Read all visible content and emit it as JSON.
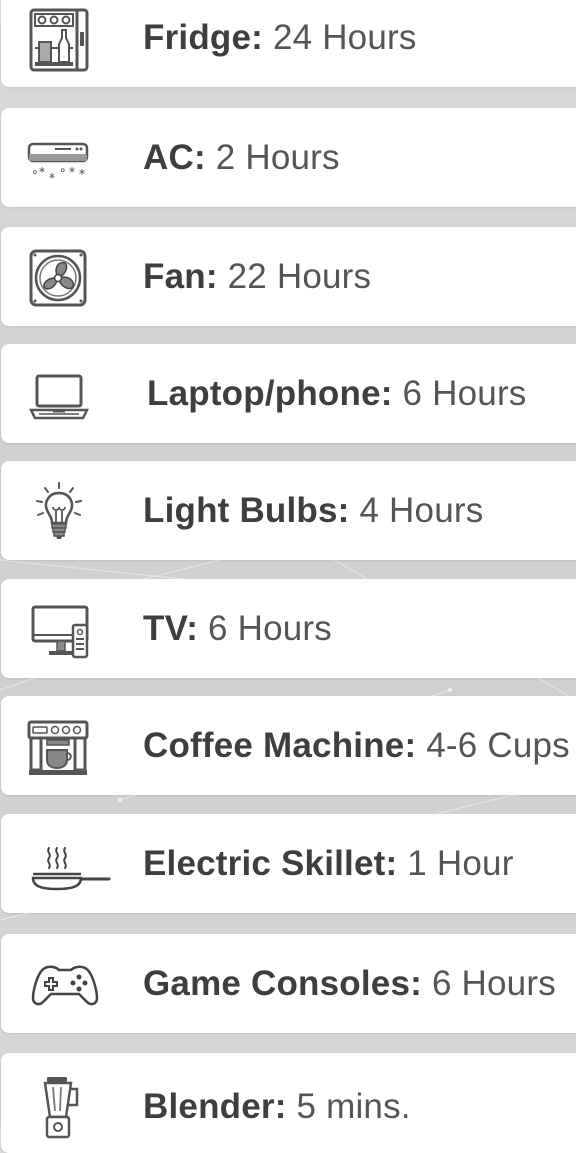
{
  "items": [
    {
      "name": "Fridge:",
      "value": "24 Hours",
      "icon": "fridge-icon"
    },
    {
      "name": "AC:",
      "value": "2 Hours",
      "icon": "air-conditioner-icon"
    },
    {
      "name": "Fan:",
      "value": "22 Hours",
      "icon": "fan-icon"
    },
    {
      "name": "Laptop/phone:",
      "value": "6 Hours",
      "icon": "laptop-icon"
    },
    {
      "name": "Light Bulbs:",
      "value": "4 Hours",
      "icon": "light-bulb-icon"
    },
    {
      "name": "TV:",
      "value": "6 Hours",
      "icon": "tv-icon"
    },
    {
      "name": "Coffee Machine:",
      "value": "4-6 Cups",
      "icon": "coffee-machine-icon"
    },
    {
      "name": "Electric Skillet:",
      "value": "1 Hour",
      "icon": "skillet-icon"
    },
    {
      "name": "Game Consoles:",
      "value": "6 Hours",
      "icon": "game-controller-icon"
    },
    {
      "name": "Blender:",
      "value": "5 mins.",
      "icon": "blender-icon"
    }
  ]
}
